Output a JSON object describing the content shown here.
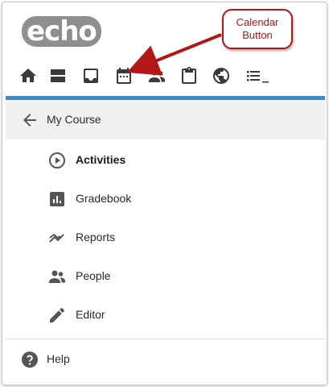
{
  "app": {
    "logo_text": "echo"
  },
  "toolbar": {
    "icons": [
      {
        "name": "home-icon"
      },
      {
        "name": "courses-icon"
      },
      {
        "name": "inbox-icon"
      },
      {
        "name": "calendar-icon"
      },
      {
        "name": "people-icon"
      },
      {
        "name": "clipboard-icon"
      },
      {
        "name": "globe-icon"
      },
      {
        "name": "list-icon"
      }
    ]
  },
  "accent_color": "#2f8ddb",
  "annotation": {
    "line1": "Calendar",
    "line2": "Button",
    "color": "#b21818"
  },
  "course": {
    "back_icon": "arrow-left-icon",
    "label": "My Course"
  },
  "nav": {
    "items": [
      {
        "label": "Activities",
        "icon": "play-circle-icon",
        "active": true
      },
      {
        "label": "Gradebook",
        "icon": "bar-chart-icon",
        "active": false
      },
      {
        "label": "Reports",
        "icon": "trend-icon",
        "active": false
      },
      {
        "label": "People",
        "icon": "people-icon",
        "active": false
      },
      {
        "label": "Editor",
        "icon": "pencil-icon",
        "active": false
      }
    ]
  },
  "help": {
    "label": "Help",
    "icon": "help-circle-icon"
  }
}
